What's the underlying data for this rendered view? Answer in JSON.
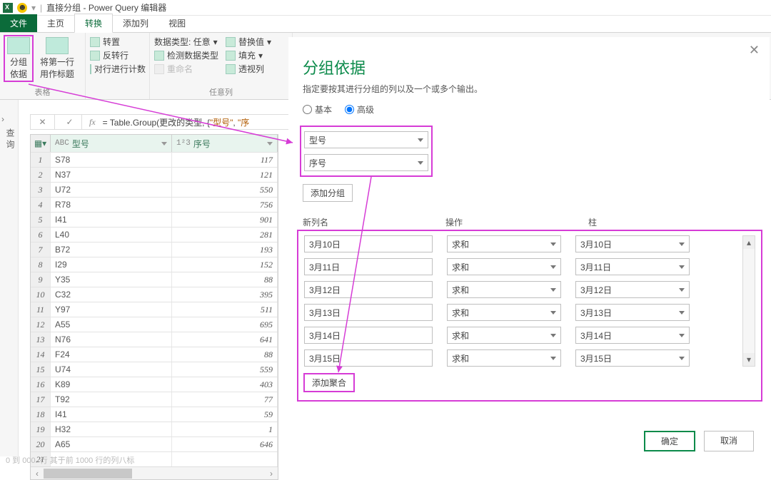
{
  "title": {
    "doc": "直接分组",
    "app": "Power Query 编辑器"
  },
  "tabs": {
    "file": "文件",
    "home": "主页",
    "transform": "转换",
    "addcol": "添加列",
    "view": "视图"
  },
  "ribbon": {
    "group_by": "分组\n依据",
    "first_row": "将第一行\n用作标题",
    "table_label": "表格",
    "transpose": "转置",
    "reverse": "反转行",
    "count_rows": "对行进行计数",
    "datatype": "数据类型: 任意",
    "detect": "检测数据类型",
    "rename": "重命名",
    "replace": "替换值",
    "fill": "填充",
    "pivot": "透视列",
    "anycol_label": "任意列"
  },
  "formula_prefix": "= Table.Group(更改的类型, {",
  "formula_q1": "\"型号\"",
  "formula_mid": ", ",
  "formula_q2": "\"序",
  "grid": {
    "col1_type": "ABC",
    "col1": "型号",
    "col2_type": "1²3",
    "col2": "序号",
    "rows": [
      {
        "a": "S78",
        "b": "117"
      },
      {
        "a": "N37",
        "b": "121"
      },
      {
        "a": "U72",
        "b": "550"
      },
      {
        "a": "R78",
        "b": "756"
      },
      {
        "a": "I41",
        "b": "901"
      },
      {
        "a": "L40",
        "b": "281"
      },
      {
        "a": "B72",
        "b": "193"
      },
      {
        "a": "I29",
        "b": "152"
      },
      {
        "a": "Y35",
        "b": "88"
      },
      {
        "a": "C32",
        "b": "395"
      },
      {
        "a": "Y97",
        "b": "511"
      },
      {
        "a": "A55",
        "b": "695"
      },
      {
        "a": "N76",
        "b": "641"
      },
      {
        "a": "F24",
        "b": "88"
      },
      {
        "a": "U74",
        "b": "559"
      },
      {
        "a": "K89",
        "b": "403"
      },
      {
        "a": "T92",
        "b": "77"
      },
      {
        "a": "I41",
        "b": "59"
      },
      {
        "a": "H32",
        "b": "1"
      },
      {
        "a": "A65",
        "b": "646"
      },
      {
        "a": "",
        "b": ""
      }
    ]
  },
  "dialog": {
    "title": "分组依据",
    "subtitle": "指定要按其进行分组的列以及一个或多个输出。",
    "radio_basic": "基本",
    "radio_adv": "高级",
    "group_cols": [
      "型号",
      "序号"
    ],
    "add_group": "添加分组",
    "hdr_new": "新列名",
    "hdr_op": "操作",
    "hdr_col": "柱",
    "op_sum": "求和",
    "aggs": [
      "3月10日",
      "3月11日",
      "3月12日",
      "3月13日",
      "3月14日",
      "3月15日"
    ],
    "add_agg": "添加聚合",
    "ok": "确定",
    "cancel": "取消"
  },
  "status": "0 到   000.  行    其于前 1000 行的列八标",
  "vlabel": "查询"
}
